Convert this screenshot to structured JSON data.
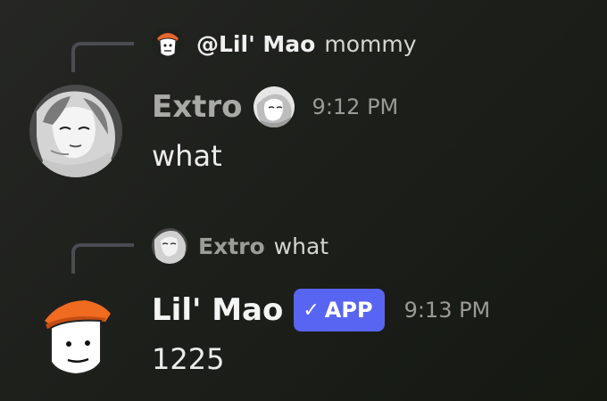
{
  "messages": [
    {
      "reply": {
        "author": "@Lil' Mao",
        "text": "mommy",
        "author_color": "#f0f0f0"
      },
      "author": "Extro",
      "author_color": "#a9aaa5",
      "timestamp": "9:12 PM",
      "content": "what"
    },
    {
      "reply": {
        "author": "Extro",
        "text": "what",
        "author_color": "#9c9d99"
      },
      "author": "Lil' Mao",
      "author_color": "#f4f4f4",
      "badge": {
        "check": "✓",
        "label": "APP",
        "color": "#5865f2"
      },
      "timestamp": "9:13 PM",
      "content": "1225"
    }
  ]
}
